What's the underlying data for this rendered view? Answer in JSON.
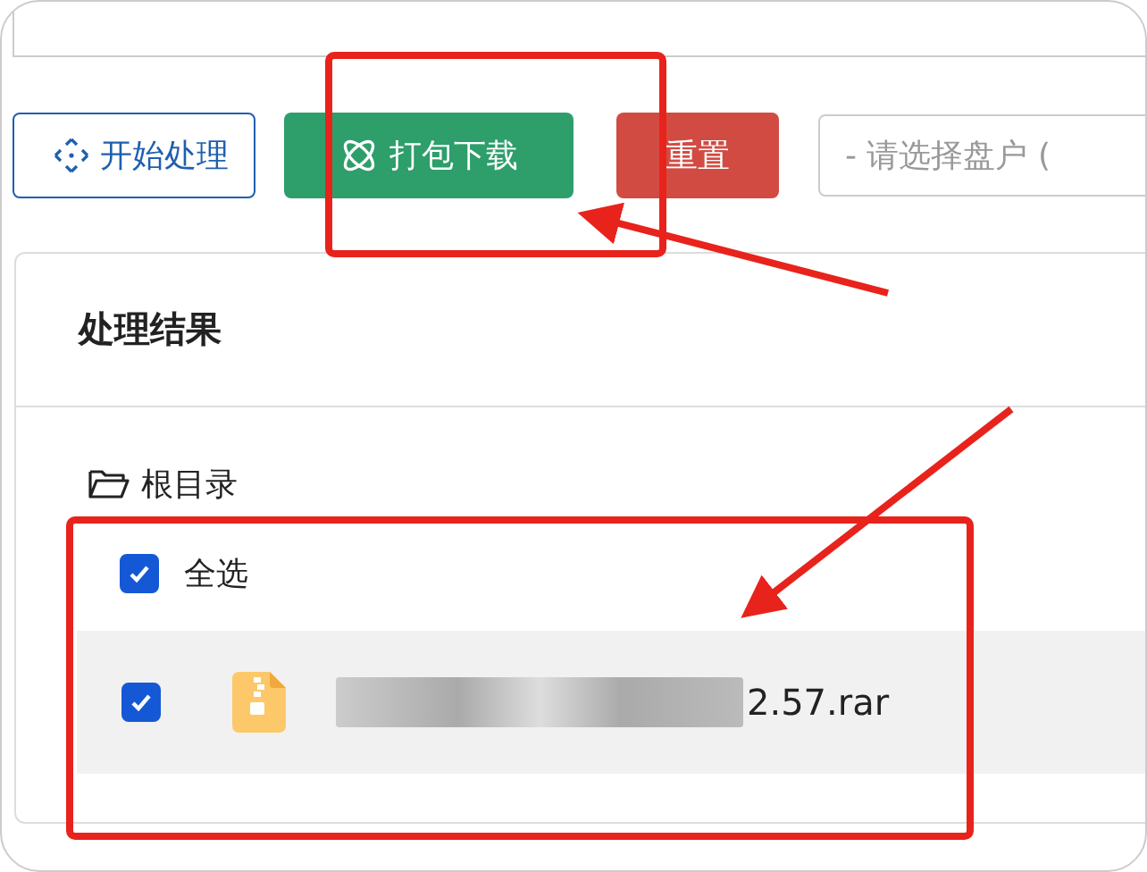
{
  "toolbar": {
    "buttons": [
      {
        "kind": "outline",
        "label": "开始处理"
      },
      {
        "kind": "success",
        "label": "打包下载"
      },
      {
        "kind": "danger",
        "label": "重置"
      }
    ],
    "select": {
      "placeholder": "- 请选择盘户 ("
    }
  },
  "results": {
    "title": "处理结果",
    "root": "根目录",
    "select_all": {
      "label": "全选",
      "checked": true
    },
    "files": [
      {
        "name": "2.57.rar",
        "checked": true,
        "selected": true
      }
    ]
  }
}
